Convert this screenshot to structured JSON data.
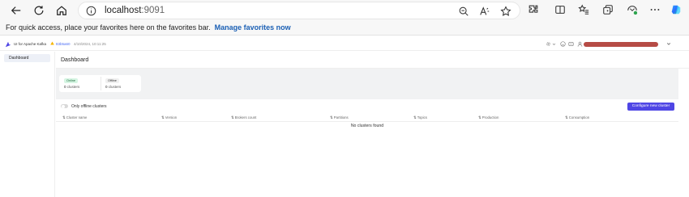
{
  "browser": {
    "url_host": "localhost",
    "url_port": ":9091",
    "favorites_prompt": "For quick access, place your favorites here on the favorites bar.",
    "favorites_link": "Manage favorites now"
  },
  "app": {
    "brand": "UI for Apache Kafka",
    "version_hash": "83b5a60",
    "version_date": "4/10/2024, 10:11:25"
  },
  "sidebar": {
    "items": [
      {
        "label": "Dashboard"
      }
    ]
  },
  "main": {
    "title": "Dashboard",
    "stats": {
      "online": {
        "label": "Online",
        "count": "0",
        "unit": " clusters"
      },
      "offline": {
        "label": "Offline",
        "count": "0",
        "unit": " clusters"
      }
    },
    "toggle_label": "Only offline clusters",
    "configure_button": "Configure new cluster",
    "columns": [
      "Cluster name",
      "Version",
      "Brokers count",
      "Partitions",
      "Topics",
      "Production",
      "Consumption"
    ],
    "empty_message": "No clusters found"
  },
  "colors": {
    "accent": "#4f46e5",
    "online_badge": "#d6f5e3",
    "link": "#1a5fb4"
  }
}
